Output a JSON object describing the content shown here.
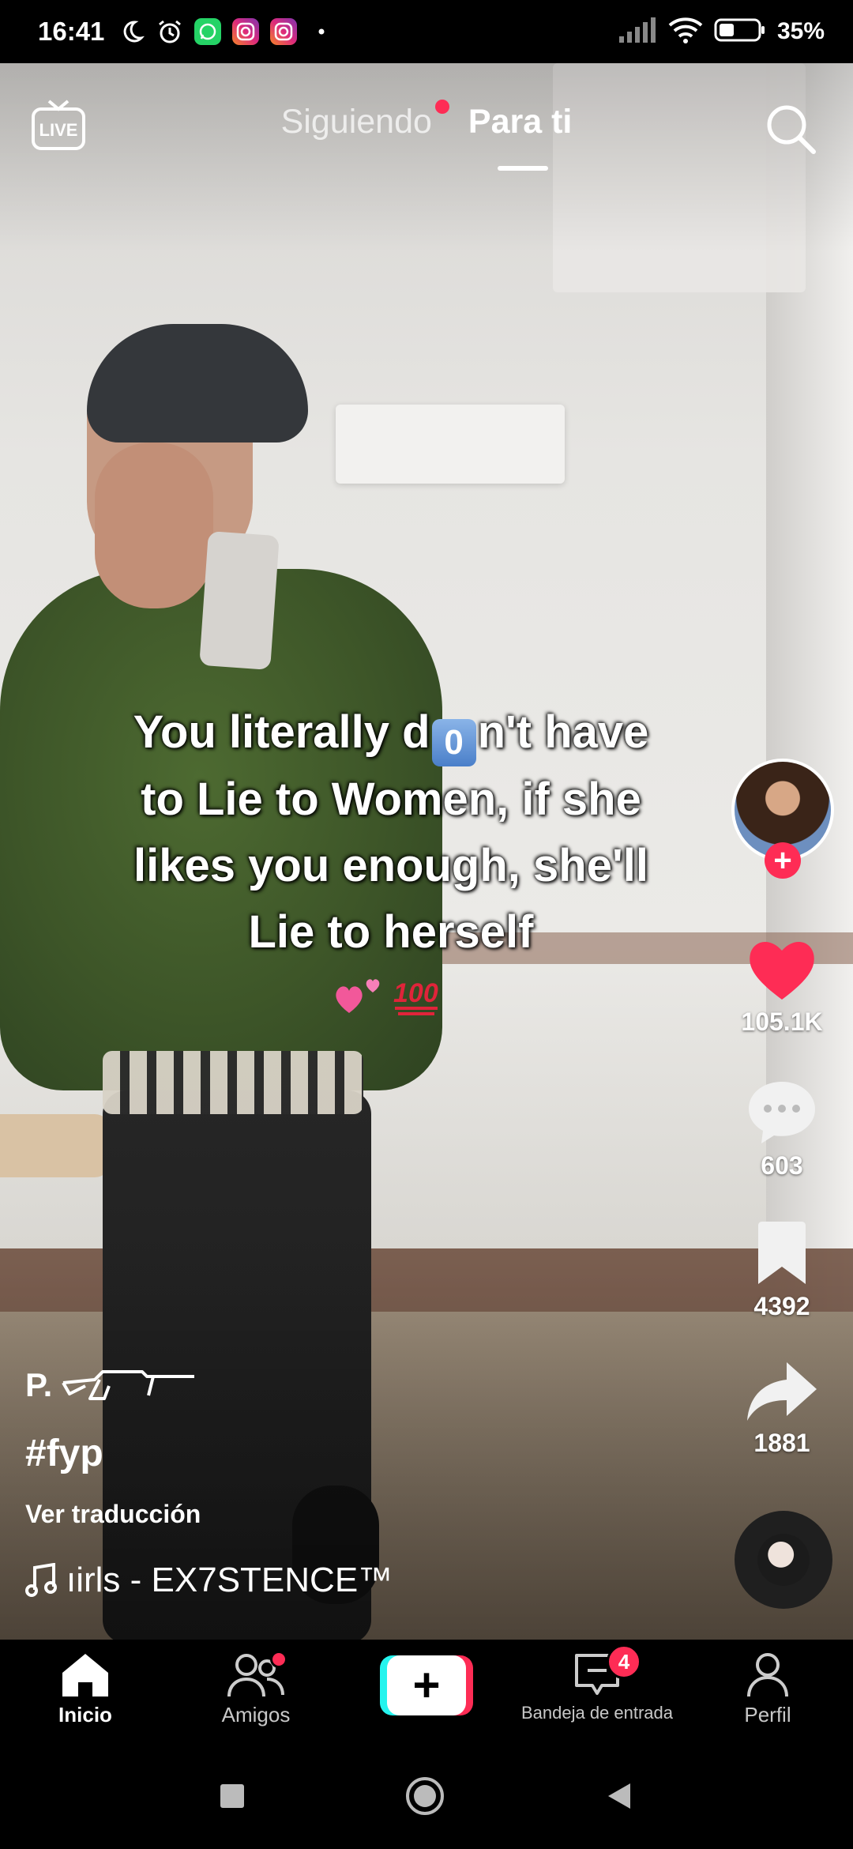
{
  "status_bar": {
    "time": "16:41",
    "battery": "35%",
    "icons": [
      "moon-icon",
      "alarm-icon",
      "whatsapp-icon",
      "instagram-icon",
      "instagram-icon",
      "dot-icon",
      "signal-icon",
      "wifi-icon",
      "battery-icon"
    ]
  },
  "top_nav": {
    "live_label": "LIVE",
    "tab_following": "Siguiendo",
    "tab_for_you": "Para ti"
  },
  "video": {
    "overlay_line1": "You literally d",
    "overlay_zero": "0",
    "overlay_line1_end": "n't have",
    "overlay_line2": "to Lie to Women, if she",
    "overlay_line3": "likes you enough, she'll",
    "overlay_line4": "Lie to herself",
    "overlay_emoji_hundred": "100"
  },
  "actions": {
    "likes": "105.1K",
    "comments": "603",
    "saves": "4392",
    "shares": "1881"
  },
  "post": {
    "username": "P.",
    "hashtag": "#fyp",
    "translate": "Ver traducción",
    "sound": "ıirls - EX7STENCE™"
  },
  "bottom_nav": {
    "home": "Inicio",
    "friends": "Amigos",
    "inbox": "Bandeja de entrada",
    "inbox_badge": "4",
    "profile": "Perfil"
  },
  "colors": {
    "accent": "#fe2c55",
    "create_cyan": "#25f4ee"
  }
}
